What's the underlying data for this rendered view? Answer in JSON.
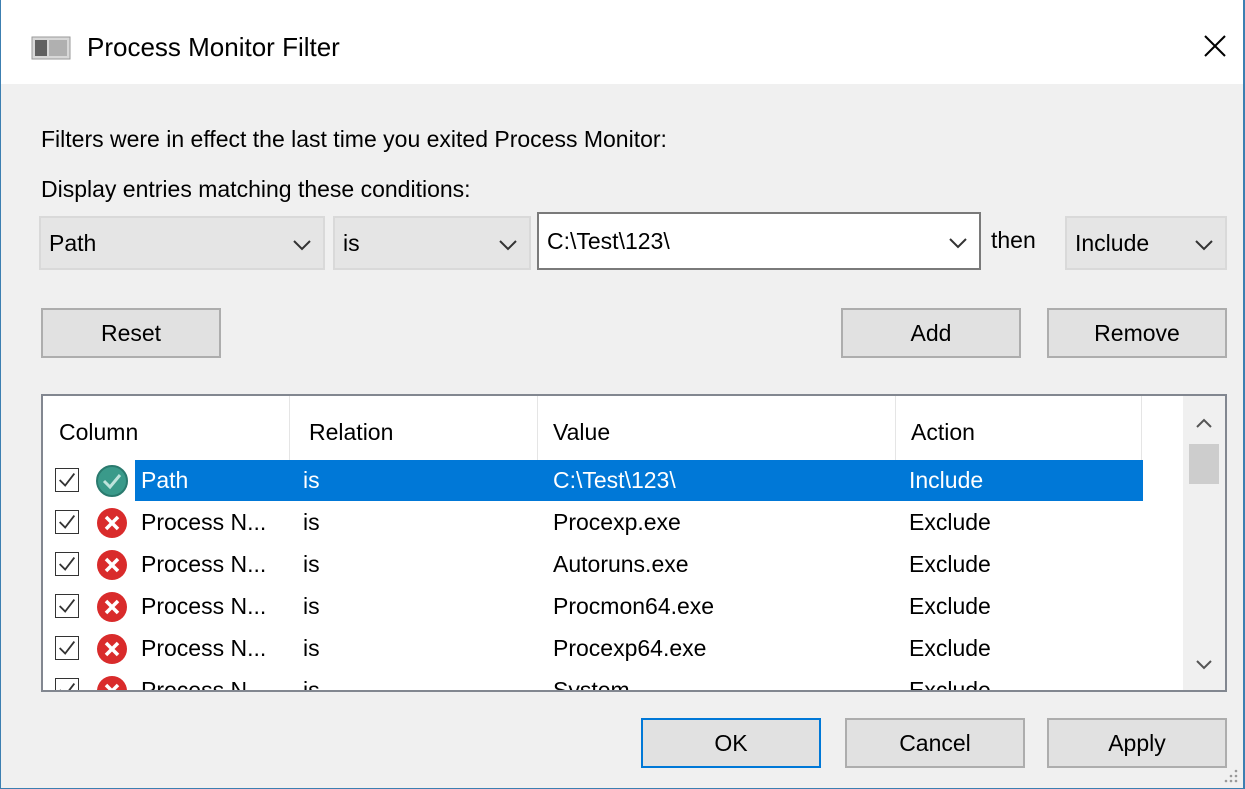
{
  "window": {
    "title": "Process Monitor Filter"
  },
  "intro": {
    "line1": "Filters were in effect the last time you exited Process Monitor:",
    "line2": "Display entries matching these conditions:"
  },
  "condition": {
    "column_value": "Path",
    "relation_value": "is",
    "value_text": "C:\\Test\\123\\",
    "then_label": "then",
    "action_value": "Include"
  },
  "buttons": {
    "reset": "Reset",
    "add": "Add",
    "remove": "Remove",
    "ok": "OK",
    "cancel": "Cancel",
    "apply": "Apply"
  },
  "list": {
    "headers": {
      "column": "Column",
      "relation": "Relation",
      "value": "Value",
      "action": "Action"
    },
    "rows": [
      {
        "column": "Path",
        "relation": "is",
        "value": "C:\\Test\\123\\",
        "action": "Include",
        "icon": "include-check-icon",
        "checked": true,
        "selected": true
      },
      {
        "column": "Process N...",
        "relation": "is",
        "value": "Procexp.exe",
        "action": "Exclude",
        "icon": "exclude-x-icon",
        "checked": true,
        "selected": false
      },
      {
        "column": "Process N...",
        "relation": "is",
        "value": "Autoruns.exe",
        "action": "Exclude",
        "icon": "exclude-x-icon",
        "checked": true,
        "selected": false
      },
      {
        "column": "Process N...",
        "relation": "is",
        "value": "Procmon64.exe",
        "action": "Exclude",
        "icon": "exclude-x-icon",
        "checked": true,
        "selected": false
      },
      {
        "column": "Process N...",
        "relation": "is",
        "value": "Procexp64.exe",
        "action": "Exclude",
        "icon": "exclude-x-icon",
        "checked": true,
        "selected": false
      },
      {
        "column": "Process N...",
        "relation": "is",
        "value": "System",
        "action": "Exclude",
        "icon": "exclude-x-icon",
        "checked": true,
        "selected": false
      }
    ]
  },
  "colors": {
    "selection": "#0078d7",
    "include_icon": "#3a9a8a",
    "exclude_icon": "#d92b2b"
  }
}
